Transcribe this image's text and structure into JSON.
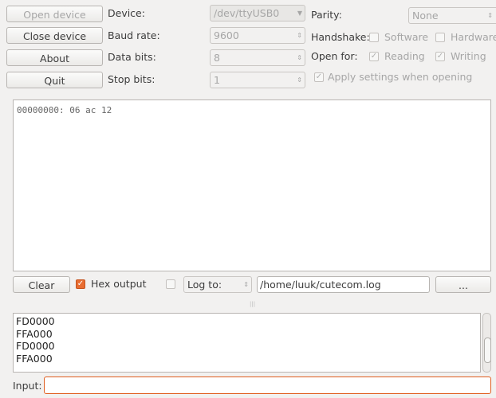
{
  "buttons": {
    "open": "Open device",
    "close": "Close device",
    "about": "About",
    "quit": "Quit"
  },
  "labels": {
    "device": "Device:",
    "baud": "Baud rate:",
    "databits": "Data bits:",
    "stopbits": "Stop bits:",
    "parity": "Parity:",
    "handshake": "Handshake:",
    "openfor": "Open for:"
  },
  "values": {
    "device": "/dev/ttyUSB0",
    "baud": "9600",
    "databits": "8",
    "stopbits": "1",
    "parity": "None"
  },
  "checks": {
    "software": "Software",
    "hardware": "Hardware",
    "reading": "Reading",
    "writing": "Writing",
    "apply": "Apply settings when opening"
  },
  "output": {
    "text": "00000000: 06 ac 12"
  },
  "bottom": {
    "clear": "Clear",
    "hex": "Hex output",
    "logto": "Log to:",
    "logpath": "/home/luuk/cutecom.log",
    "browse": "..."
  },
  "history": [
    "FD0000",
    "FFA000",
    "FD0000",
    "FFA000"
  ],
  "input": {
    "label": "Input:",
    "value": ""
  },
  "colors": {
    "accent": "#e05e1f"
  }
}
